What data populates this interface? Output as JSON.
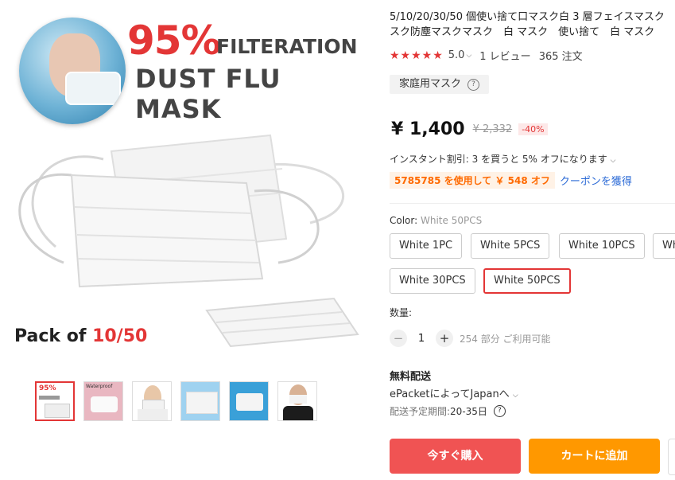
{
  "gallery": {
    "banner_percent": "95%",
    "banner_filtration": "FILTERATION",
    "banner_product": "DUST FLU MASK",
    "pack_prefix": "Pack of ",
    "pack_count": "10/50",
    "thumbnail_count": 6,
    "selected_thumbnail": 0,
    "thumbnails": [
      {
        "name": "thumb-1",
        "text": "95%"
      },
      {
        "name": "thumb-2",
        "text": "Waterproof"
      },
      {
        "name": "thumb-3"
      },
      {
        "name": "thumb-4"
      },
      {
        "name": "thumb-5"
      },
      {
        "name": "thumb-6"
      }
    ]
  },
  "product": {
    "title_line1": "5/10/20/30/50 個使い捨て口マスク白 3 層フェイスマスク",
    "title_line2": "スク防塵マスクマスク　白 マスク　使い捨て　白 マスク",
    "rating": "5.0",
    "reviews": "1 レビュー",
    "orders": "365 注文",
    "category_tag": "家庭用マスク"
  },
  "pricing": {
    "price": "¥ 1,400",
    "original_price": "¥ 2,332",
    "discount": "-40%",
    "instant_discount": "インスタント割引: 3 を買うと 5% オフになります",
    "coupon_code": "5785785 を使用して ￥ 548 オフ",
    "coupon_link": "クーポンを獲得"
  },
  "variants": {
    "label": "Color: ",
    "selected_value": "White 50PCS",
    "options": [
      "White 1PC",
      "White 5PCS",
      "White 10PCS",
      "Wh",
      "White 30PCS",
      "White 50PCS"
    ]
  },
  "quantity": {
    "label": "数量:",
    "value": "1",
    "available": "254 部分 ご利用可能"
  },
  "shipping": {
    "title": "無料配送",
    "method": "ePacketによってJapanへ",
    "eta_label": "配送予定期間: ",
    "eta_value": "20-35日"
  },
  "actions": {
    "buy_now": "今すぐ購入",
    "add_to_cart": "カートに追加"
  },
  "colors": {
    "accent_red": "#e33636",
    "buy_button": "#f05353",
    "cart_button": "#ff9800",
    "coupon_orange": "#ff6a00",
    "link_blue": "#2b6ad6"
  }
}
